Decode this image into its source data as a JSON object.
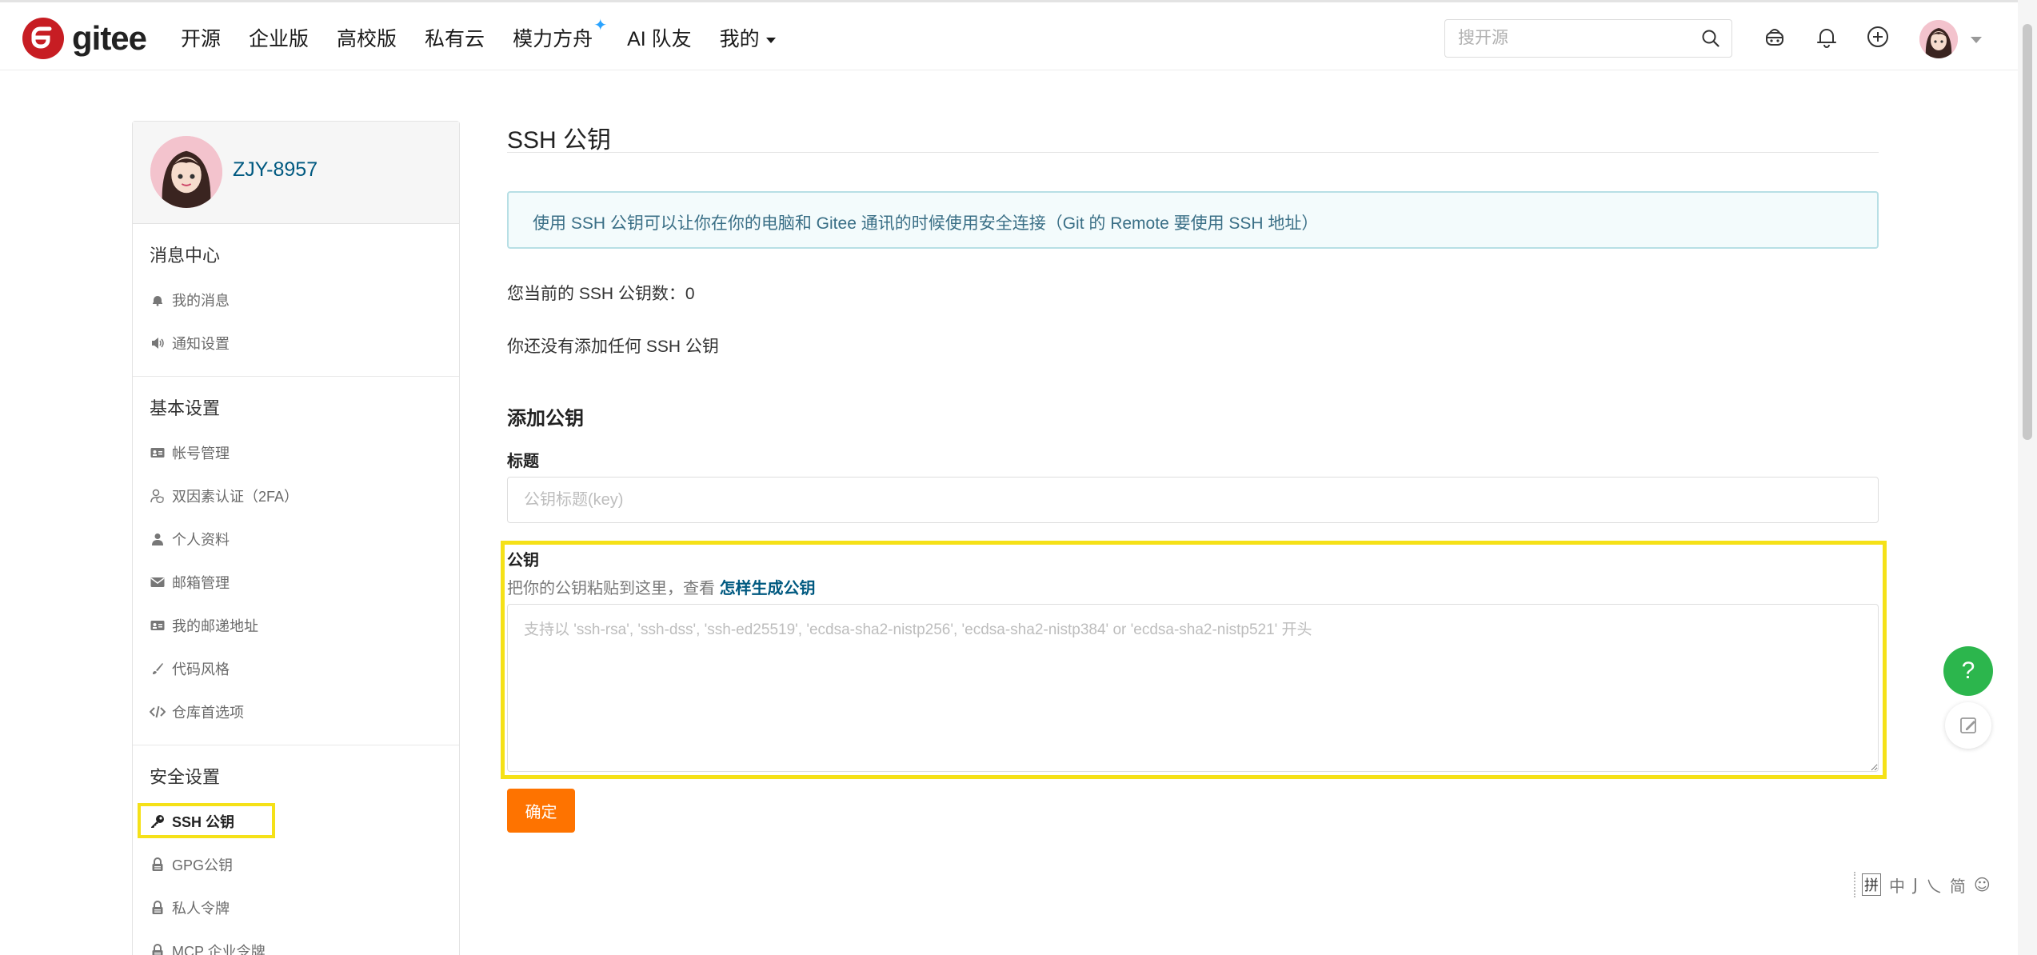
{
  "header": {
    "logo_text": "gitee",
    "nav": [
      {
        "label": "开源"
      },
      {
        "label": "企业版"
      },
      {
        "label": "高校版"
      },
      {
        "label": "私有云"
      },
      {
        "label": "模力方舟",
        "badge": "✦"
      },
      {
        "label": "AI 队友"
      },
      {
        "label": "我的"
      }
    ],
    "search_placeholder": "搜开源"
  },
  "sidebar": {
    "username": "ZJY-8957",
    "sections": [
      {
        "title": "消息中心",
        "items": [
          {
            "label": "我的消息",
            "icon": "bell-icon"
          },
          {
            "label": "通知设置",
            "icon": "speaker-icon"
          }
        ]
      },
      {
        "title": "基本设置",
        "items": [
          {
            "label": "帐号管理",
            "icon": "id-card-icon"
          },
          {
            "label": "双因素认证（2FA）",
            "icon": "user-shield-icon"
          },
          {
            "label": "个人资料",
            "icon": "user-icon"
          },
          {
            "label": "邮箱管理",
            "icon": "envelope-icon"
          },
          {
            "label": "我的邮递地址",
            "icon": "address-card-icon"
          },
          {
            "label": "代码风格",
            "icon": "brush-icon"
          },
          {
            "label": "仓库首选项",
            "icon": "code-icon"
          }
        ]
      },
      {
        "title": "安全设置",
        "items": [
          {
            "label": "SSH 公钥",
            "icon": "key-icon",
            "active": true
          },
          {
            "label": "GPG公钥",
            "icon": "lock-icon"
          },
          {
            "label": "私人令牌",
            "icon": "lock-icon"
          },
          {
            "label": "MCP 企业令牌",
            "icon": "lock-icon"
          }
        ]
      }
    ]
  },
  "main": {
    "page_title": "SSH 公钥",
    "info_text": "使用 SSH 公钥可以让你在你的电脑和 Gitee 通讯的时候使用安全连接（Git 的 Remote 要使用 SSH 地址）",
    "count_label": "您当前的 SSH 公钥数：",
    "count_value": "0",
    "none_text": "你还没有添加任何 SSH 公钥",
    "add_title": "添加公钥",
    "title_label": "标题",
    "title_placeholder": "公钥标题(key)",
    "key_label": "公钥",
    "key_hint": "把你的公钥粘贴到这里，查看",
    "key_hint_link": "怎样生成公钥",
    "key_placeholder": "支持以 'ssh-rsa', 'ssh-dss', 'ssh-ed25519', 'ecdsa-sha2-nistp256', 'ecdsa-sha2-nistp384' or 'ecdsa-sha2-nistp521' 开头",
    "submit_label": "确定"
  },
  "widgets": {
    "help_label": "?",
    "ime_glyphs": [
      "拼",
      "中",
      "J",
      "乀",
      "简",
      "☺"
    ]
  },
  "colors": {
    "brand_red": "#c71d23",
    "link_blue": "#005980",
    "submit_orange": "#fe7300",
    "highlight_yellow": "#f5e118",
    "help_green": "#2cb64d"
  }
}
